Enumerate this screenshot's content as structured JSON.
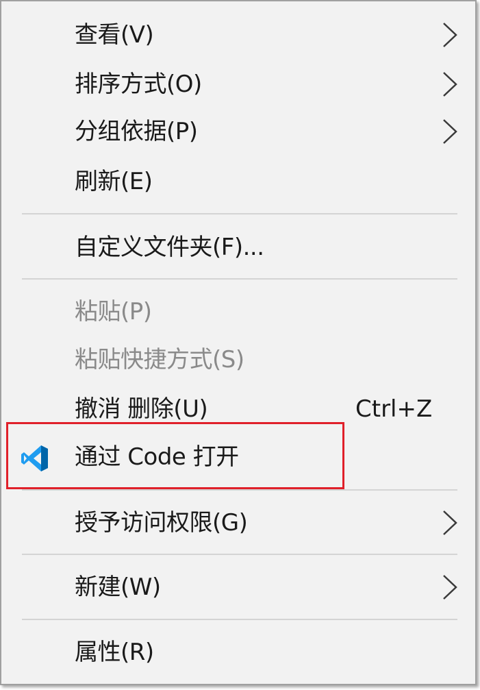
{
  "menu": {
    "items": [
      {
        "label": "查看(V)",
        "submenu": true
      },
      {
        "label": "排序方式(O)",
        "submenu": true
      },
      {
        "label": "分组依据(P)",
        "submenu": true
      },
      {
        "label": "刷新(E)",
        "submenu": false
      },
      {
        "label": "自定义文件夹(F)...",
        "submenu": false
      },
      {
        "label": "粘贴(P)",
        "disabled": true
      },
      {
        "label": "粘贴快捷方式(S)",
        "disabled": true
      },
      {
        "label": "撤消 删除(U)",
        "shortcut": "Ctrl+Z"
      },
      {
        "label": "通过 Code 打开",
        "icon": "vscode-icon"
      },
      {
        "label": "授予访问权限(G)",
        "submenu": true
      },
      {
        "label": "新建(W)",
        "submenu": true
      },
      {
        "label": "属性(R)",
        "submenu": false
      }
    ]
  },
  "colors": {
    "menu_background": "#f2f2f2",
    "text": "#1a1a1a",
    "disabled_text": "#8a8a8a",
    "separator": "#d4d4d4",
    "highlight_border": "#e0202a",
    "vscode_blue": "#1f9cf0"
  }
}
